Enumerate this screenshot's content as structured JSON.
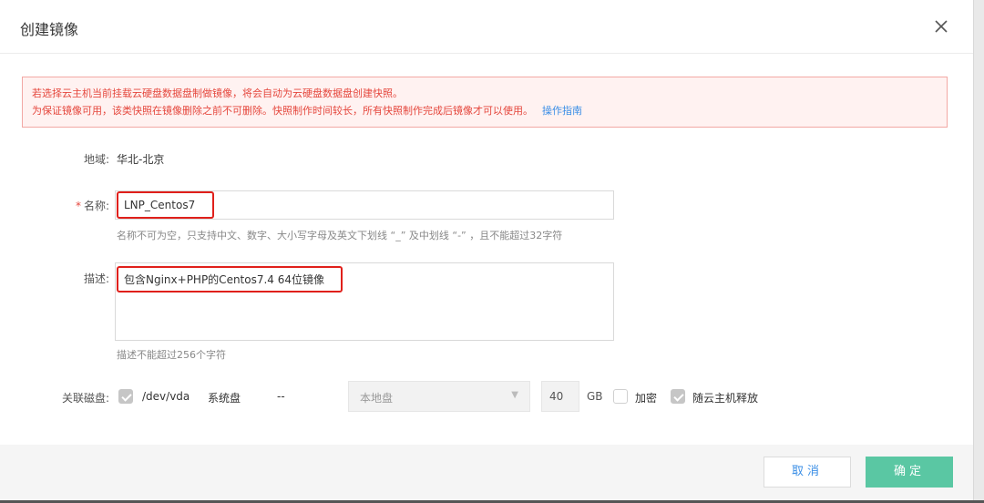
{
  "dialog": {
    "title": "创建镜像"
  },
  "alert": {
    "line1": "若选择云主机当前挂载云硬盘数据盘制做镜像，将会自动为云硬盘数据盘创建快照。",
    "line2": "为保证镜像可用，该类快照在镜像删除之前不可删除。快照制作时间较长，所有快照制作完成后镜像才可以使用。",
    "guide_link": "操作指南"
  },
  "form": {
    "region": {
      "label": "地域:",
      "value": "华北-北京"
    },
    "name": {
      "label": "名称:",
      "required_mark": "*",
      "value": "LNP_Centos7",
      "hint": "名称不可为空，只支持中文、数字、大小写字母及英文下划线 “_” 及中划线 “-” ，且不能超过32字符"
    },
    "description": {
      "label": "描述:",
      "value": "包含Nginx+PHP的Centos7.4 64位镜像",
      "hint": "描述不能超过256个字符"
    },
    "disk": {
      "label": "关联磁盘:",
      "checked": true,
      "device": "/dev/vda",
      "type": "系统盘",
      "dash": "--",
      "storage": "本地盘",
      "size": "40",
      "unit": "GB",
      "encrypt_label": "加密",
      "encrypt_checked": false,
      "release_label": "随云主机释放",
      "release_checked": true
    }
  },
  "footer": {
    "cancel": "取消",
    "confirm": "确定"
  },
  "colors": {
    "alert_text": "#e5473d",
    "alert_border": "#f2a8a4",
    "link": "#3a8ee6",
    "confirm_bg": "#5ac7a3",
    "highlight": "#e0201b"
  },
  "icons": {
    "close": "close-icon",
    "caret": "chevron-down-icon",
    "check": "check-icon"
  }
}
